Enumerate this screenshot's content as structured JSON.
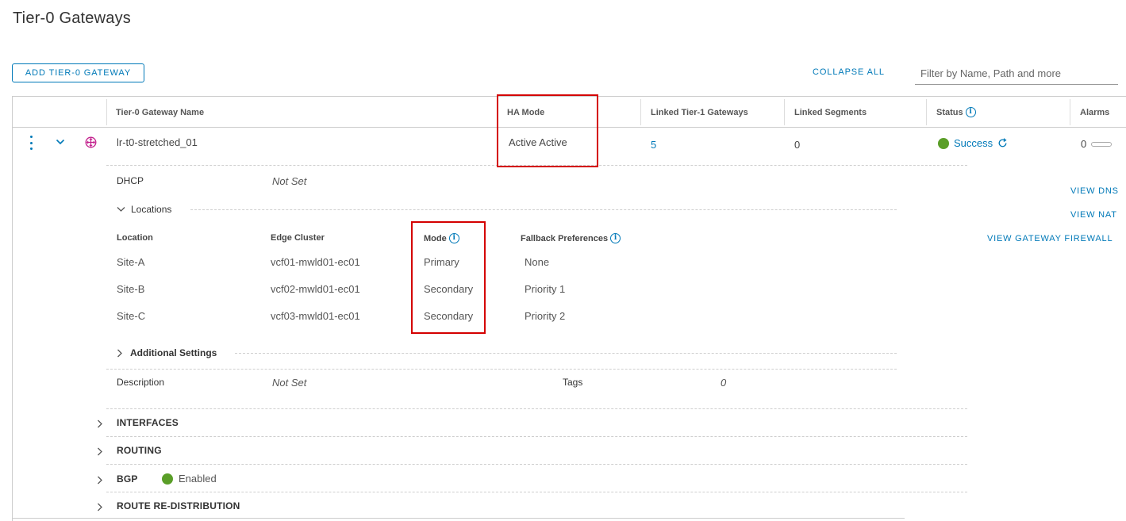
{
  "page": {
    "title": "Tier-0 Gateways"
  },
  "toolbar": {
    "add_label": "ADD TIER-0 GATEWAY",
    "collapse_label": "COLLAPSE ALL",
    "filter_placeholder": "Filter by Name, Path and more"
  },
  "table": {
    "columns": {
      "name": "Tier-0 Gateway Name",
      "ha_mode": "HA Mode",
      "linked_t1": "Linked Tier-1 Gateways",
      "linked_segments": "Linked Segments",
      "status": "Status",
      "alarms": "Alarms"
    },
    "row": {
      "name": "lr-t0-stretched_01",
      "ha_mode": "Active Active",
      "linked_t1": "5",
      "linked_segments": "0",
      "status": "Success",
      "alarms": "0"
    }
  },
  "details": {
    "dhcp_label": "DHCP",
    "dhcp_value": "Not Set",
    "locations_label": "Locations",
    "loc_headers": {
      "location": "Location",
      "edge_cluster": "Edge Cluster",
      "mode": "Mode",
      "fallback": "Fallback Preferences"
    },
    "locations": [
      {
        "location": "Site-A",
        "edge_cluster": "vcf01-mwld01-ec01",
        "mode": "Primary",
        "fallback": "None"
      },
      {
        "location": "Site-B",
        "edge_cluster": "vcf02-mwld01-ec01",
        "mode": "Secondary",
        "fallback": "Priority 1"
      },
      {
        "location": "Site-C",
        "edge_cluster": "vcf03-mwld01-ec01",
        "mode": "Secondary",
        "fallback": "Priority 2"
      }
    ],
    "additional_settings_label": "Additional Settings",
    "description_label": "Description",
    "description_value": "Not Set",
    "tags_label": "Tags",
    "tags_value": "0"
  },
  "sections": {
    "interfaces": "INTERFACES",
    "routing": "ROUTING",
    "bgp": "BGP",
    "bgp_status": "Enabled",
    "route_redistribution": "ROUTE RE-DISTRIBUTION"
  },
  "actions": {
    "view_dns": "VIEW DNS",
    "view_nat": "VIEW NAT",
    "view_firewall": "VIEW GATEWAY FIREWALL"
  },
  "colors": {
    "accent": "#0079b8",
    "success": "#5a9e28",
    "highlight": "#d40000",
    "gateway_icon": "#c21d8b"
  },
  "icons": {
    "row_menu": "vertical-dots-icon",
    "expand": "chevron-down-icon",
    "gateway": "tier0-gateway-icon",
    "info": "info-icon",
    "refresh": "refresh-icon"
  }
}
